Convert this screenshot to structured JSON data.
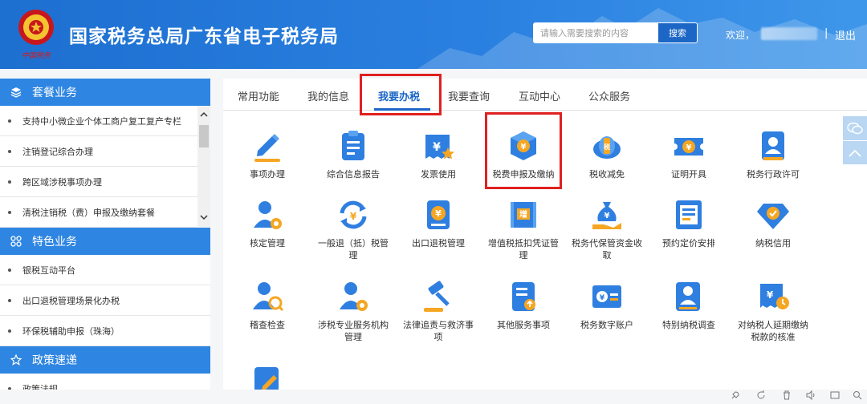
{
  "header": {
    "title": "国家税务总局广东省电子税务局",
    "search_placeholder": "请输入需要搜索的内容",
    "search_button": "搜索",
    "welcome": "欢迎，",
    "separator": "|",
    "logout": "退出",
    "emblem_text": "中国税务"
  },
  "sidebar": {
    "sections": [
      {
        "title": "套餐业务",
        "icon": "layers-icon",
        "items": [
          "支持中小微企业个体工商户复工复产专栏",
          "注销登记综合办理",
          "跨区域涉税事项办理",
          "清税注销税（费）申报及缴纳套餐"
        ]
      },
      {
        "title": "特色业务",
        "icon": "grid-icon",
        "items": [
          "银税互动平台",
          "出口退税管理场景化办税",
          "环保税辅助申报（珠海）"
        ]
      },
      {
        "title": "政策速递",
        "icon": "star-icon",
        "items": [
          "政策法规"
        ]
      }
    ]
  },
  "tabs": [
    {
      "label": "常用功能"
    },
    {
      "label": "我的信息"
    },
    {
      "label": "我要办税",
      "active": true
    },
    {
      "label": "我要查询"
    },
    {
      "label": "互动中心"
    },
    {
      "label": "公众服务"
    }
  ],
  "grid": [
    {
      "label": "事项办理",
      "icon": "pen-icon"
    },
    {
      "label": "综合信息报告",
      "icon": "clipboard-icon"
    },
    {
      "label": "发票使用",
      "icon": "invoice-icon"
    },
    {
      "label": "税费申报及缴纳",
      "icon": "yuan-box-icon"
    },
    {
      "label": "税收减免",
      "icon": "tax-relief-icon"
    },
    {
      "label": "证明开具",
      "icon": "ticket-icon"
    },
    {
      "label": "税务行政许可",
      "icon": "license-icon"
    },
    {
      "label": "核定管理",
      "icon": "user-gear-icon"
    },
    {
      "label": "一般退（抵）税管理",
      "icon": "refund-icon"
    },
    {
      "label": "出口退税管理",
      "icon": "export-refund-icon"
    },
    {
      "label": "增值税抵扣凭证管理",
      "icon": "vat-voucher-icon"
    },
    {
      "label": "税务代保管资金收取",
      "icon": "money-bag-icon"
    },
    {
      "label": "预约定价安排",
      "icon": "document-list-icon"
    },
    {
      "label": "纳税信用",
      "icon": "credit-diamond-icon"
    },
    {
      "label": "稽查检查",
      "icon": "inspector-icon"
    },
    {
      "label": "涉税专业服务机构管理",
      "icon": "agent-gear-icon"
    },
    {
      "label": "法律追责与救济事项",
      "icon": "gavel-icon"
    },
    {
      "label": "其他服务事项",
      "icon": "service-list-icon"
    },
    {
      "label": "税务数字账户",
      "icon": "digital-account-icon"
    },
    {
      "label": "特别纳税调查",
      "icon": "special-search-icon"
    },
    {
      "label": "对纳税人延期缴纳税款的核准",
      "icon": "deferral-icon"
    },
    {
      "label": "",
      "icon": "edit-doc-icon"
    }
  ],
  "colors": {
    "header_blue": "#2a80e0",
    "accent_blue": "#1c66c6",
    "icon_blue": "#2f7fe0",
    "icon_orange": "#f5a623",
    "highlight_red": "#e02020"
  }
}
